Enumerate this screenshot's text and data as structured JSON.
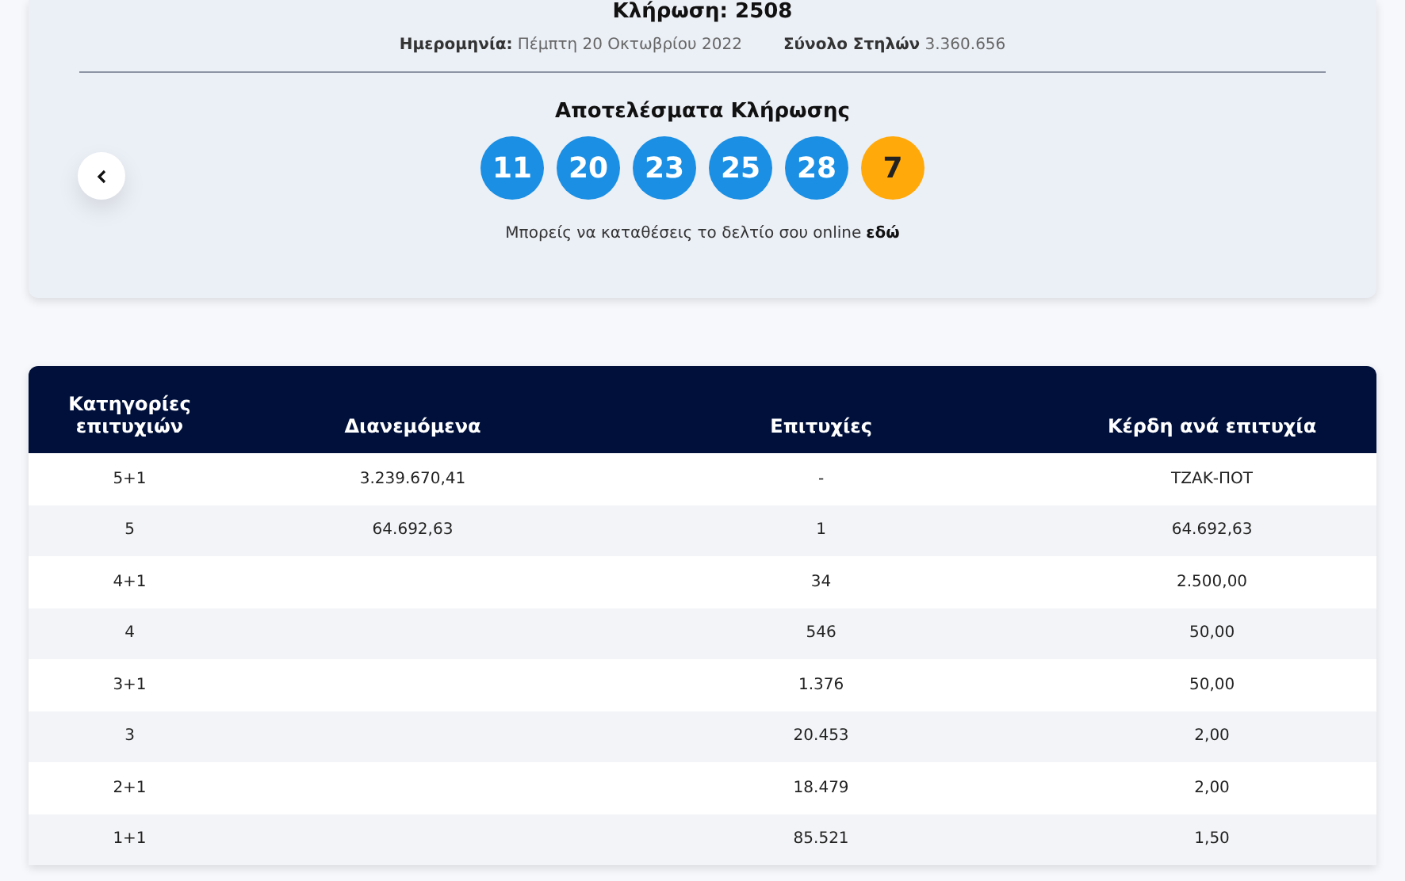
{
  "draw": {
    "title": "Κλήρωση: 2508",
    "date_label": "Ημερομηνία:",
    "date_value": "Πέμπτη 20 Οκτωβρίου 2022",
    "columns_label": "Σύνολο Στηλών",
    "columns_value": "3.360.656"
  },
  "results": {
    "heading": "Αποτελέσματα Κλήρωσης",
    "balls": [
      {
        "number": "11",
        "kind": "main"
      },
      {
        "number": "20",
        "kind": "main"
      },
      {
        "number": "23",
        "kind": "main"
      },
      {
        "number": "25",
        "kind": "main"
      },
      {
        "number": "28",
        "kind": "main"
      },
      {
        "number": "7",
        "kind": "bonus"
      }
    ],
    "online_note": "Μπορείς να καταθέσεις το δελτίο σου online",
    "online_link": "εδώ"
  },
  "table": {
    "columns": [
      "Κατηγορίες επιτυχιών",
      "Διανεμόμενα",
      "Επιτυχίες",
      "Κέρδη ανά επιτυχία"
    ],
    "rows": [
      [
        "5+1",
        "3.239.670,41",
        "-",
        "ΤΖΑΚ-ΠΟΤ"
      ],
      [
        "5",
        "64.692,63",
        "1",
        "64.692,63"
      ],
      [
        "4+1",
        "",
        "34",
        "2.500,00"
      ],
      [
        "4",
        "",
        "546",
        "50,00"
      ],
      [
        "3+1",
        "",
        "1.376",
        "50,00"
      ],
      [
        "3",
        "",
        "20.453",
        "2,00"
      ],
      [
        "2+1",
        "",
        "18.479",
        "2,00"
      ],
      [
        "1+1",
        "",
        "85.521",
        "1,50"
      ]
    ]
  }
}
